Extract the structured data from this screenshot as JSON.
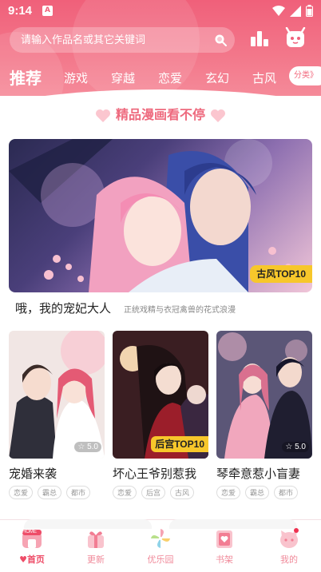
{
  "status_bar": {
    "time": "9:14",
    "notif_badge": "A"
  },
  "search": {
    "placeholder": "请输入作品名或其它关键词"
  },
  "tabs": [
    {
      "label": "推荐",
      "active": true
    },
    {
      "label": "游戏"
    },
    {
      "label": "穿越"
    },
    {
      "label": "恋爱"
    },
    {
      "label": "玄幻"
    },
    {
      "label": "古风"
    }
  ],
  "category_button": "分类》",
  "section": {
    "title": "精品漫画看不停"
  },
  "featured": {
    "tag": "古风TOP10",
    "title": "哦，我的宠妃大人",
    "description": "正统戏精与衣冠禽兽的花式浪漫"
  },
  "cards": [
    {
      "title": "宠婚来袭",
      "score": "5.0",
      "tags": [
        "恋爱",
        "霸总",
        "都市"
      ]
    },
    {
      "title": "坏心王爷别惹我",
      "badge": "后宫TOP10",
      "tags": [
        "恋爱",
        "后宫",
        "古风"
      ]
    },
    {
      "title": "琴牵意惹小盲妻",
      "score": "5.0",
      "tags": [
        "恋爱",
        "霸总",
        "都市"
      ]
    }
  ],
  "bottom_nav": [
    {
      "label": "首页",
      "icon": "home-icon",
      "active": true,
      "badge": "HOME"
    },
    {
      "label": "更新",
      "icon": "gift-icon"
    },
    {
      "label": "优乐园",
      "icon": "pinwheel-icon"
    },
    {
      "label": "书架",
      "icon": "bookshelf-icon"
    },
    {
      "label": "我的",
      "icon": "profile-icon"
    }
  ],
  "colors": {
    "brand_pink": "#f0607a",
    "tag_yellow": "#f7c72b"
  }
}
